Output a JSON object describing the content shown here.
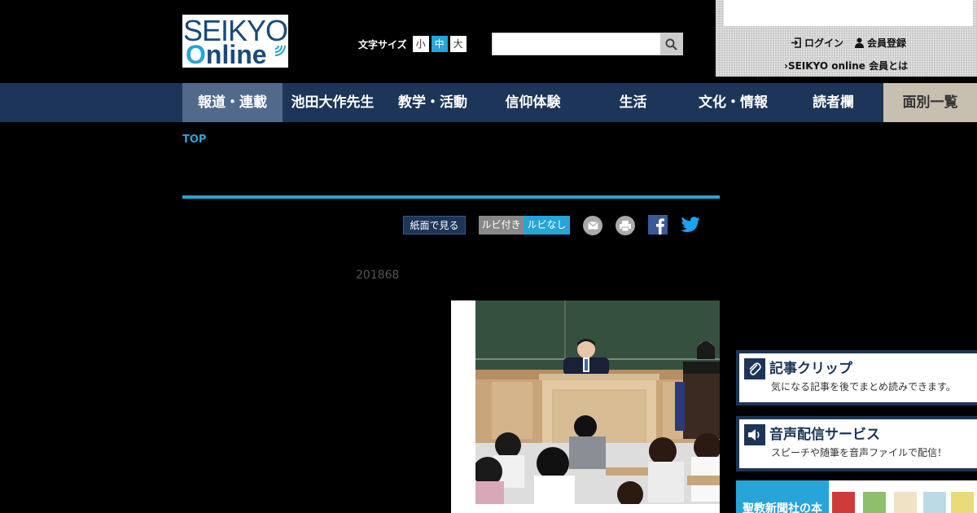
{
  "logo": {
    "line1": "SEIKYO",
    "line2_o": "O",
    "line2_rest": "nline"
  },
  "font_size": {
    "label": "文字サイズ",
    "small": "小",
    "medium": "中",
    "large": "大",
    "selected": "中"
  },
  "search": {
    "placeholder": ""
  },
  "account": {
    "login": "ログイン",
    "register": "会員登録",
    "about": "SEIKYO online 会員とは"
  },
  "nav": {
    "items": [
      "報道・連載",
      "池田大作先生",
      "教学・活動",
      "信仰体験",
      "生活",
      "文化・情報",
      "読者欄",
      "面別一覧"
    ],
    "active": "報道・連載"
  },
  "breadcrumb": {
    "top": "TOP"
  },
  "tools": {
    "paper_view": "紙面で見る",
    "ruby_on": "ルビ付き",
    "ruby_off": "ルビなし"
  },
  "article": {
    "date": "201868"
  },
  "sidebar": {
    "clip": {
      "title": "記事クリップ",
      "subtitle": "気になる記事を後でまとめ読みできます。"
    },
    "audio": {
      "title": "音声配信サービス",
      "subtitle": "スピーチや随筆を音声ファイルで配信！"
    },
    "books": {
      "label": "聖教新聞社の本"
    }
  },
  "colors": {
    "nav_bg": "#1c3558",
    "accent": "#27a4d8",
    "menu_bg": "#c7bfb0"
  }
}
